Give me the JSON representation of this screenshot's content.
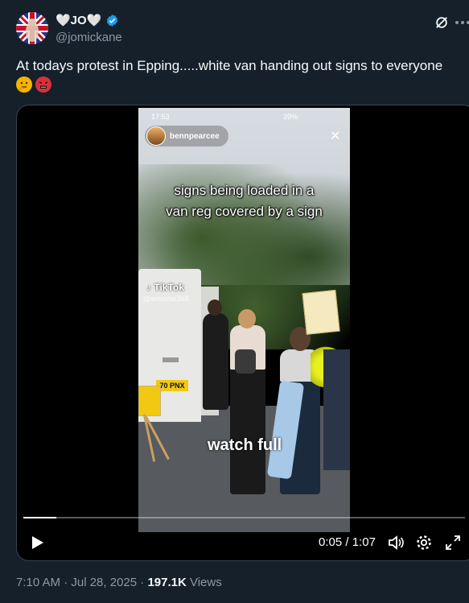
{
  "author": {
    "display_name": "🤍JO🤍",
    "handle": "@jomickane",
    "verified": true
  },
  "tweet": {
    "text": "At todays protest in Epping.....white van handing out signs to everyone",
    "emojis": [
      "thinking-face-emoji",
      "angry-face-emoji"
    ]
  },
  "video": {
    "status_time": "17:53",
    "status_right": "39%",
    "overlay_username": "bennpearcee",
    "caption_line1": "signs being loaded in a",
    "caption_line2": "van reg covered by a sign",
    "watermark": "TikTok",
    "watermark_user": "@amostar268",
    "watch_text": "watch full",
    "plate_text": "70 PNX",
    "current_time": "0:05",
    "separator": "/",
    "duration": "1:07",
    "progress": 0.075
  },
  "footer": {
    "timestamp": "7:10 AM · Jul 28, 2025 · ",
    "views_count": "197.1K",
    "views_label": " Views"
  },
  "colors": {
    "background": "#15202b",
    "verified_blue": "#1d9bf0",
    "secondary_text": "#8b98a5",
    "border": "#38444d"
  }
}
